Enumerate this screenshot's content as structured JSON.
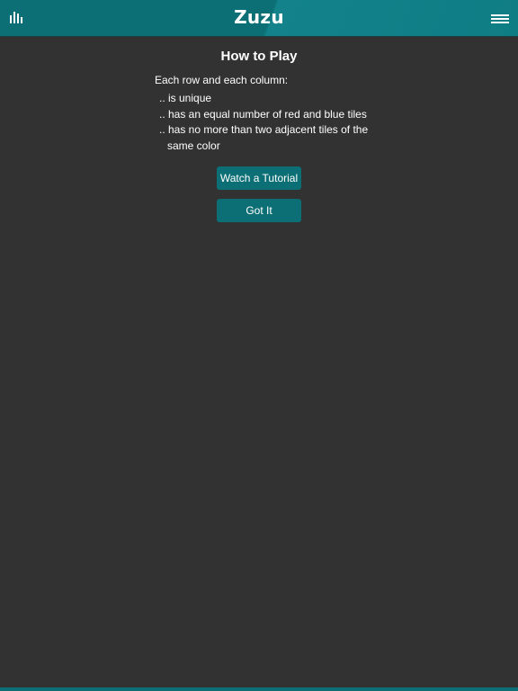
{
  "header": {
    "title": "Zuzu",
    "left_icon": "stats-bars-icon",
    "right_icon": "hamburger-menu-icon"
  },
  "how_to_play": {
    "title": "How to Play",
    "intro": "Each row and each column:",
    "rules": [
      ".. is unique",
      ".. has an equal number of red and blue tiles",
      ".. has no more than two adjacent tiles of the same color"
    ]
  },
  "buttons": {
    "tutorial_label": "Watch a Tutorial",
    "gotit_label": "Got It"
  },
  "colors": {
    "accent": "#0b6f75",
    "background": "#323232",
    "text": "#ffffff"
  }
}
